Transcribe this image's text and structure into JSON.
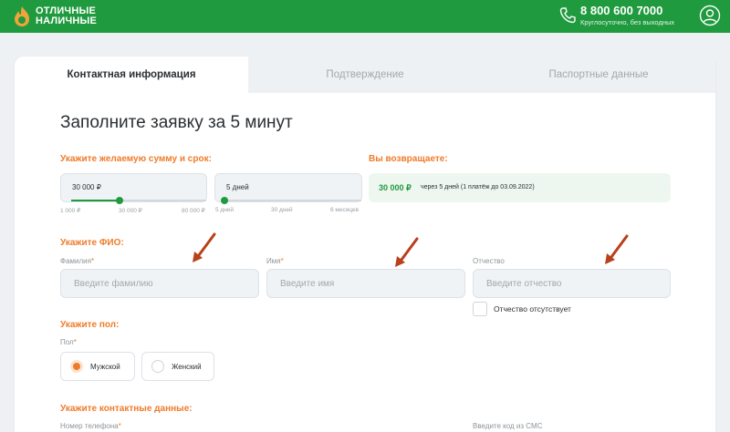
{
  "header": {
    "logo_line1": "ОТЛИЧНЫЕ",
    "logo_line2": "НАЛИЧНЫЕ",
    "phone": "8 800 600 7000",
    "phone_note": "Круглосуточно, без выходных"
  },
  "tabs": [
    {
      "label": "Контактная информация",
      "active": true
    },
    {
      "label": "Подтверждение",
      "active": false
    },
    {
      "label": "Паспортные данные",
      "active": false
    }
  ],
  "form": {
    "title": "Заполните заявку за 5 минут",
    "loan": {
      "section_label": "Укажите желаемую сумму и срок:",
      "amount_value": "30 000 ₽",
      "amount_fill": 0.36,
      "amount_ticks": [
        "1 000 ₽",
        "30 000 ₽",
        "80 000 ₽"
      ],
      "term_value": "5 дней",
      "term_fill": 0.0,
      "term_ticks": [
        "5 дней",
        "30 дней",
        "6 месяцев"
      ],
      "return_label": "Вы возвращаете:",
      "return_amount": "30 000 ₽",
      "return_details": "через 5 дней (1 платёж до 03.09.2022)"
    },
    "fio": {
      "section_label": "Укажите ФИО:",
      "surname_label": "Фамилия",
      "surname_placeholder": "Введите фамилию",
      "name_label": "Имя",
      "name_placeholder": "Введите имя",
      "patronymic_label": "Отчество",
      "patronymic_placeholder": "Введите отчество",
      "no_patronymic": "Отчество отсутствует",
      "required_mark": "*"
    },
    "gender": {
      "section_label": "Укажите пол:",
      "field_label": "Пол",
      "male": "Мужской",
      "female": "Женский",
      "selected": "male"
    },
    "contacts": {
      "section_label": "Укажите контактные данные:",
      "phone_label": "Номер телефона",
      "sms_label": "Введите код из СМС"
    }
  },
  "colors": {
    "brand_green": "#1f9a3e",
    "accent_orange": "#ef7b2a",
    "annotation_arrow": "#b8401b"
  }
}
